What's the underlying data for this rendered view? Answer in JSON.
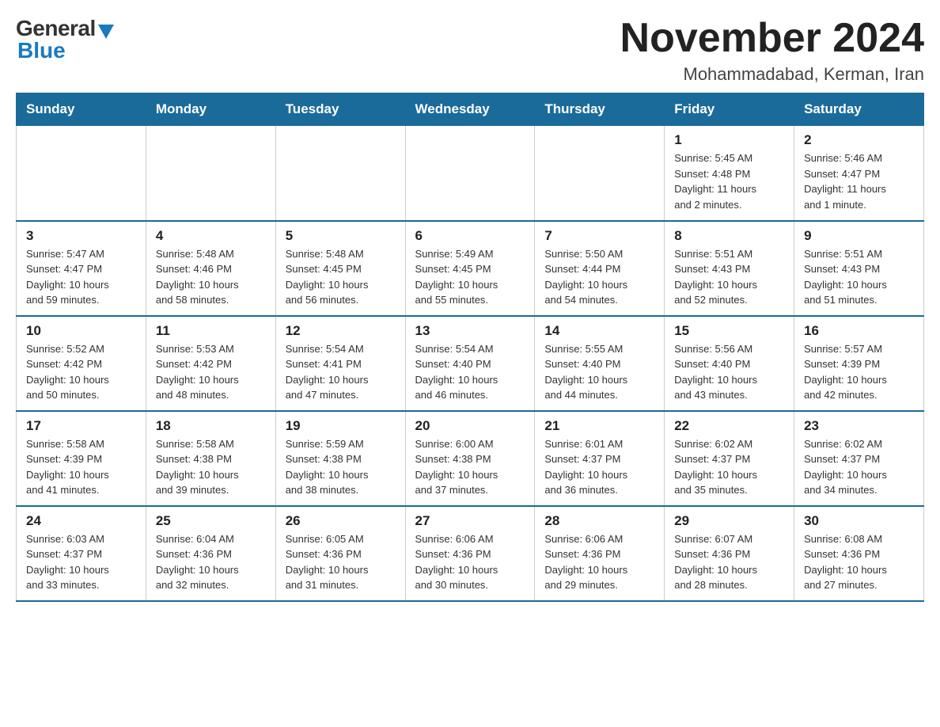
{
  "logo": {
    "general": "General",
    "blue": "Blue"
  },
  "title": "November 2024",
  "location": "Mohammadabad, Kerman, Iran",
  "days_header": [
    "Sunday",
    "Monday",
    "Tuesday",
    "Wednesday",
    "Thursday",
    "Friday",
    "Saturday"
  ],
  "weeks": [
    [
      {
        "day": "",
        "info": ""
      },
      {
        "day": "",
        "info": ""
      },
      {
        "day": "",
        "info": ""
      },
      {
        "day": "",
        "info": ""
      },
      {
        "day": "",
        "info": ""
      },
      {
        "day": "1",
        "info": "Sunrise: 5:45 AM\nSunset: 4:48 PM\nDaylight: 11 hours\nand 2 minutes."
      },
      {
        "day": "2",
        "info": "Sunrise: 5:46 AM\nSunset: 4:47 PM\nDaylight: 11 hours\nand 1 minute."
      }
    ],
    [
      {
        "day": "3",
        "info": "Sunrise: 5:47 AM\nSunset: 4:47 PM\nDaylight: 10 hours\nand 59 minutes."
      },
      {
        "day": "4",
        "info": "Sunrise: 5:48 AM\nSunset: 4:46 PM\nDaylight: 10 hours\nand 58 minutes."
      },
      {
        "day": "5",
        "info": "Sunrise: 5:48 AM\nSunset: 4:45 PM\nDaylight: 10 hours\nand 56 minutes."
      },
      {
        "day": "6",
        "info": "Sunrise: 5:49 AM\nSunset: 4:45 PM\nDaylight: 10 hours\nand 55 minutes."
      },
      {
        "day": "7",
        "info": "Sunrise: 5:50 AM\nSunset: 4:44 PM\nDaylight: 10 hours\nand 54 minutes."
      },
      {
        "day": "8",
        "info": "Sunrise: 5:51 AM\nSunset: 4:43 PM\nDaylight: 10 hours\nand 52 minutes."
      },
      {
        "day": "9",
        "info": "Sunrise: 5:51 AM\nSunset: 4:43 PM\nDaylight: 10 hours\nand 51 minutes."
      }
    ],
    [
      {
        "day": "10",
        "info": "Sunrise: 5:52 AM\nSunset: 4:42 PM\nDaylight: 10 hours\nand 50 minutes."
      },
      {
        "day": "11",
        "info": "Sunrise: 5:53 AM\nSunset: 4:42 PM\nDaylight: 10 hours\nand 48 minutes."
      },
      {
        "day": "12",
        "info": "Sunrise: 5:54 AM\nSunset: 4:41 PM\nDaylight: 10 hours\nand 47 minutes."
      },
      {
        "day": "13",
        "info": "Sunrise: 5:54 AM\nSunset: 4:40 PM\nDaylight: 10 hours\nand 46 minutes."
      },
      {
        "day": "14",
        "info": "Sunrise: 5:55 AM\nSunset: 4:40 PM\nDaylight: 10 hours\nand 44 minutes."
      },
      {
        "day": "15",
        "info": "Sunrise: 5:56 AM\nSunset: 4:40 PM\nDaylight: 10 hours\nand 43 minutes."
      },
      {
        "day": "16",
        "info": "Sunrise: 5:57 AM\nSunset: 4:39 PM\nDaylight: 10 hours\nand 42 minutes."
      }
    ],
    [
      {
        "day": "17",
        "info": "Sunrise: 5:58 AM\nSunset: 4:39 PM\nDaylight: 10 hours\nand 41 minutes."
      },
      {
        "day": "18",
        "info": "Sunrise: 5:58 AM\nSunset: 4:38 PM\nDaylight: 10 hours\nand 39 minutes."
      },
      {
        "day": "19",
        "info": "Sunrise: 5:59 AM\nSunset: 4:38 PM\nDaylight: 10 hours\nand 38 minutes."
      },
      {
        "day": "20",
        "info": "Sunrise: 6:00 AM\nSunset: 4:38 PM\nDaylight: 10 hours\nand 37 minutes."
      },
      {
        "day": "21",
        "info": "Sunrise: 6:01 AM\nSunset: 4:37 PM\nDaylight: 10 hours\nand 36 minutes."
      },
      {
        "day": "22",
        "info": "Sunrise: 6:02 AM\nSunset: 4:37 PM\nDaylight: 10 hours\nand 35 minutes."
      },
      {
        "day": "23",
        "info": "Sunrise: 6:02 AM\nSunset: 4:37 PM\nDaylight: 10 hours\nand 34 minutes."
      }
    ],
    [
      {
        "day": "24",
        "info": "Sunrise: 6:03 AM\nSunset: 4:37 PM\nDaylight: 10 hours\nand 33 minutes."
      },
      {
        "day": "25",
        "info": "Sunrise: 6:04 AM\nSunset: 4:36 PM\nDaylight: 10 hours\nand 32 minutes."
      },
      {
        "day": "26",
        "info": "Sunrise: 6:05 AM\nSunset: 4:36 PM\nDaylight: 10 hours\nand 31 minutes."
      },
      {
        "day": "27",
        "info": "Sunrise: 6:06 AM\nSunset: 4:36 PM\nDaylight: 10 hours\nand 30 minutes."
      },
      {
        "day": "28",
        "info": "Sunrise: 6:06 AM\nSunset: 4:36 PM\nDaylight: 10 hours\nand 29 minutes."
      },
      {
        "day": "29",
        "info": "Sunrise: 6:07 AM\nSunset: 4:36 PM\nDaylight: 10 hours\nand 28 minutes."
      },
      {
        "day": "30",
        "info": "Sunrise: 6:08 AM\nSunset: 4:36 PM\nDaylight: 10 hours\nand 27 minutes."
      }
    ]
  ]
}
